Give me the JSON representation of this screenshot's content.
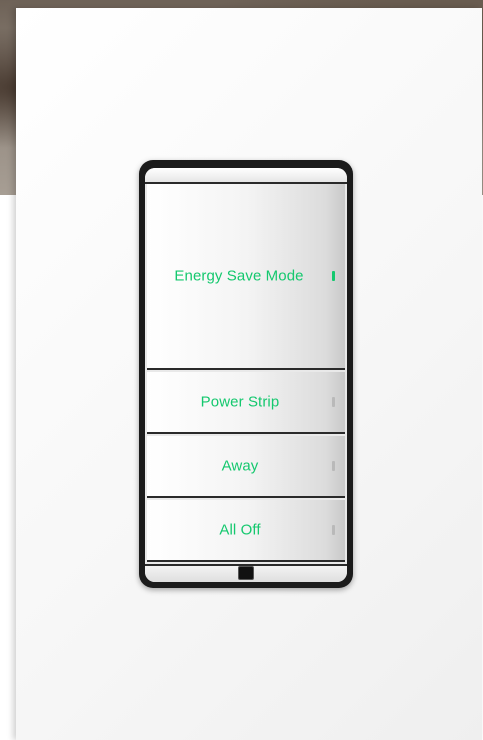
{
  "keypad": {
    "buttons": [
      {
        "label": "Energy Save Mode",
        "led_on": true
      },
      {
        "label": "Power Strip",
        "led_on": false
      },
      {
        "label": "Away",
        "led_on": false
      },
      {
        "label": "All Off",
        "led_on": false
      }
    ],
    "label_color": "#14c86e"
  }
}
